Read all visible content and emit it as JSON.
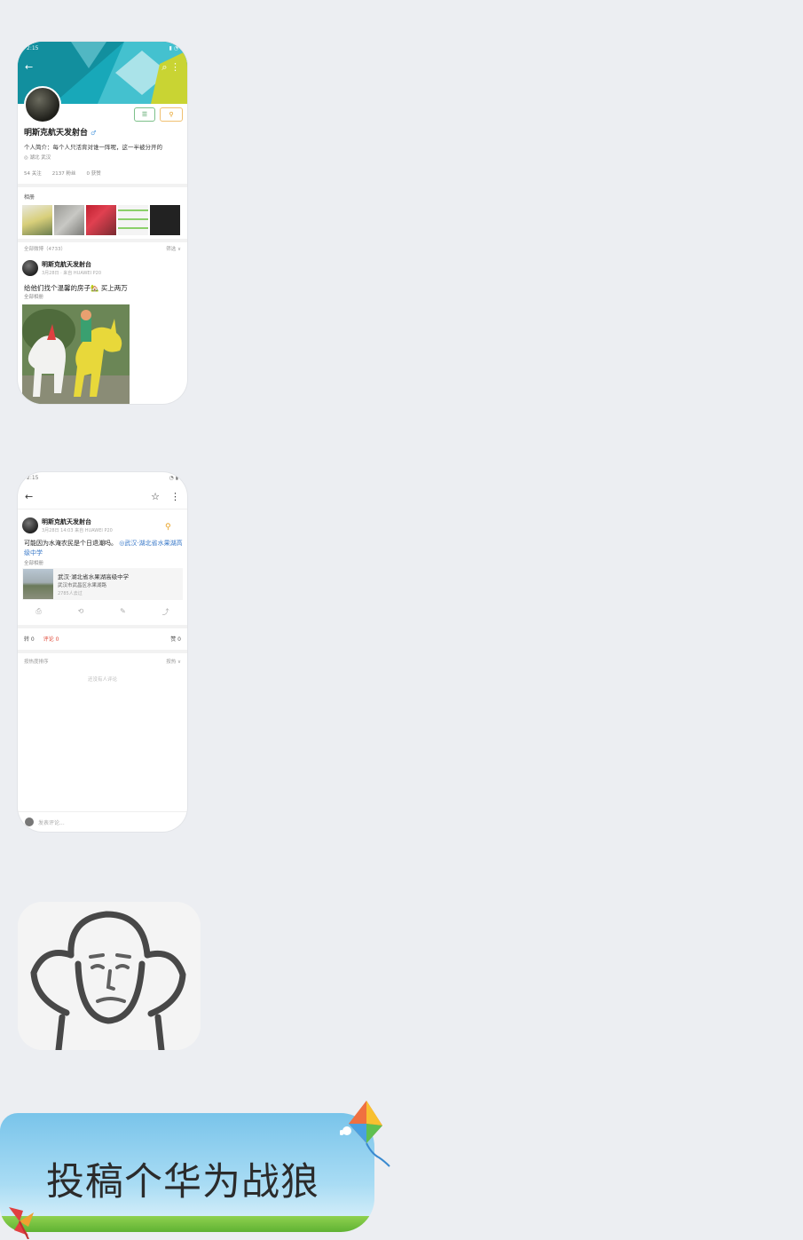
{
  "profile": {
    "status_time": "2:15",
    "name": "明斯克航天发射台",
    "bio": "个人简介：每个人只活背对谁一阵呢，这一半被分开的",
    "location": "◎ 湖北 武汉",
    "stats": [
      "54 关注",
      "2137 粉丝",
      "0 获赞"
    ],
    "albums_label": "相册",
    "filter_left": "全部微博（4733）",
    "filter_right": "筛选 ∨",
    "post": {
      "author": "明斯克航天发射台",
      "meta": "3月28日 · 来自 HUAWEI P20",
      "text": "给他们找个温馨的房子🏡 买上两万",
      "source": "全部相册"
    }
  },
  "detail": {
    "status_time": "2:15",
    "author": "明斯克航天发射台",
    "meta": "3月28日 14:03 来自 HUAWEI P20",
    "text_main": "可能因为水淹农民是个日退潮吗。",
    "text_link": "◎武汉·湖北省水果湖高级中学",
    "source": "全部相册",
    "card_title": "武汉·湖北省水果湖高级中学",
    "card_sub": "武汉市武昌区水果湖路",
    "card_sub2": "2785人去过",
    "reposts": "转 0",
    "comments": "评论 0",
    "likes": "赞 0",
    "sort_left": "按热度排序",
    "sort_right": "按热 ∨",
    "empty_hint": "还没有人评论",
    "comment_placeholder": "发表评论..."
  },
  "bubble": {
    "text": "投稿个华为战狼"
  }
}
